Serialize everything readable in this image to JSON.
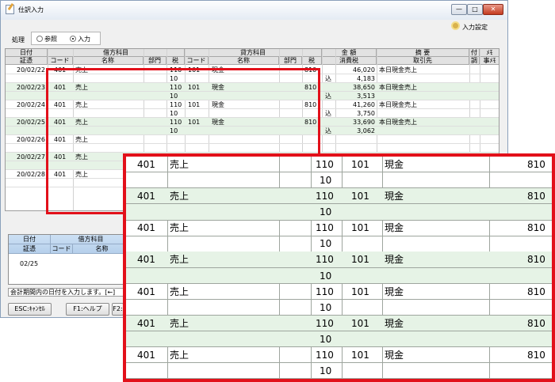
{
  "window": {
    "title": "仕訳入力",
    "minimize": "—",
    "maximize": "□",
    "close": "✕"
  },
  "toolbar": {
    "process_label": "処理",
    "mode_reference": "参照",
    "mode_input": "入力",
    "mode_selected": "入力",
    "input_settings": "入力設定"
  },
  "header": {
    "row1": {
      "date": "日付",
      "debit": "借方科目",
      "credit": "貸方科目",
      "amount": "金 額",
      "summary": "摘 要",
      "attach": "付",
      "memo": "ﾒﾓ"
    },
    "row2": {
      "voucher": "証憑",
      "debit_code": "コード",
      "debit_name": "名称",
      "debit_dept": "部門",
      "debit_tax": "税",
      "credit_code": "コード",
      "credit_name": "名称",
      "credit_dept": "部門",
      "credit_tax": "税",
      "tax_amount": "消費税",
      "partner": "取引先",
      "adjust": "調",
      "matter": "事ﾒﾓ"
    }
  },
  "entries": [
    {
      "date": "20/02/22",
      "debit_code": "401",
      "debit_name": "売上",
      "debit_tax": "110",
      "credit_code": "101",
      "credit_name": "現金",
      "credit_tax": "810",
      "amount": "46,020",
      "summary": "本日現金売上",
      "sub_tax": "10",
      "tax_flag": "込",
      "tax_amount": "4,183"
    },
    {
      "date": "20/02/23",
      "debit_code": "401",
      "debit_name": "売上",
      "debit_tax": "110",
      "credit_code": "101",
      "credit_name": "現金",
      "credit_tax": "810",
      "amount": "38,650",
      "summary": "本日現金売上",
      "sub_tax": "10",
      "tax_flag": "込",
      "tax_amount": "3,513"
    },
    {
      "date": "20/02/24",
      "debit_code": "401",
      "debit_name": "売上",
      "debit_tax": "110",
      "credit_code": "101",
      "credit_name": "現金",
      "credit_tax": "810",
      "amount": "41,260",
      "summary": "本日現金売上",
      "sub_tax": "10",
      "tax_flag": "込",
      "tax_amount": "3,750"
    },
    {
      "date": "20/02/25",
      "debit_code": "401",
      "debit_name": "売上",
      "debit_tax": "110",
      "credit_code": "101",
      "credit_name": "現金",
      "credit_tax": "810",
      "amount": "33,690",
      "summary": "本日現金売上",
      "sub_tax": "10",
      "tax_flag": "込",
      "tax_amount": "3,062"
    },
    {
      "date": "20/02/26",
      "debit_code": "401",
      "debit_name": "売上",
      "debit_tax": "",
      "credit_code": "",
      "credit_name": "",
      "credit_tax": "",
      "amount": "",
      "summary": "",
      "sub_tax": "",
      "tax_flag": "",
      "tax_amount": ""
    },
    {
      "date": "20/02/27",
      "debit_code": "401",
      "debit_name": "売上",
      "debit_tax": "",
      "credit_code": "",
      "credit_name": "",
      "credit_tax": "",
      "amount": "",
      "summary": "",
      "sub_tax": "",
      "tax_flag": "",
      "tax_amount": ""
    },
    {
      "date": "20/02/28",
      "debit_code": "401",
      "debit_name": "売上",
      "debit_tax": "",
      "credit_code": "",
      "credit_name": "",
      "credit_tax": "",
      "amount": "",
      "summary": "",
      "sub_tax": "",
      "tax_flag": "",
      "tax_amount": ""
    }
  ],
  "lower": {
    "date": "日付",
    "debit": "借方科目",
    "voucher": "証憑",
    "code": "コード",
    "name": "名称",
    "date_value": "02/25"
  },
  "status": {
    "text": "会計期間内の日付を入力します。[←]"
  },
  "fkeys": {
    "esc": "ESC:ｷｬﾝｾﾙ",
    "f1": "F1:ヘルプ",
    "f2": "F2:"
  },
  "zoom": {
    "rows": [
      {
        "debit_code": "401",
        "debit_name": "売上",
        "debit_tax": "110",
        "credit_code": "101",
        "credit_name": "現金",
        "credit_tax": "810",
        "sub_tax": "10"
      },
      {
        "debit_code": "401",
        "debit_name": "売上",
        "debit_tax": "110",
        "credit_code": "101",
        "credit_name": "現金",
        "credit_tax": "810",
        "sub_tax": "10"
      },
      {
        "debit_code": "401",
        "debit_name": "売上",
        "debit_tax": "110",
        "credit_code": "101",
        "credit_name": "現金",
        "credit_tax": "810",
        "sub_tax": "10"
      },
      {
        "debit_code": "401",
        "debit_name": "売上",
        "debit_tax": "110",
        "credit_code": "101",
        "credit_name": "現金",
        "credit_tax": "810",
        "sub_tax": "10"
      },
      {
        "debit_code": "401",
        "debit_name": "売上",
        "debit_tax": "110",
        "credit_code": "101",
        "credit_name": "現金",
        "credit_tax": "810",
        "sub_tax": "10"
      },
      {
        "debit_code": "401",
        "debit_name": "売上",
        "debit_tax": "110",
        "credit_code": "101",
        "credit_name": "現金",
        "credit_tax": "810",
        "sub_tax": "10"
      },
      {
        "debit_code": "401",
        "debit_name": "売上",
        "debit_tax": "110",
        "credit_code": "101",
        "credit_name": "現金",
        "credit_tax": "810",
        "sub_tax": "10"
      }
    ]
  },
  "colors": {
    "highlight": "#e2101a",
    "even_row": "#e6f3e6"
  }
}
